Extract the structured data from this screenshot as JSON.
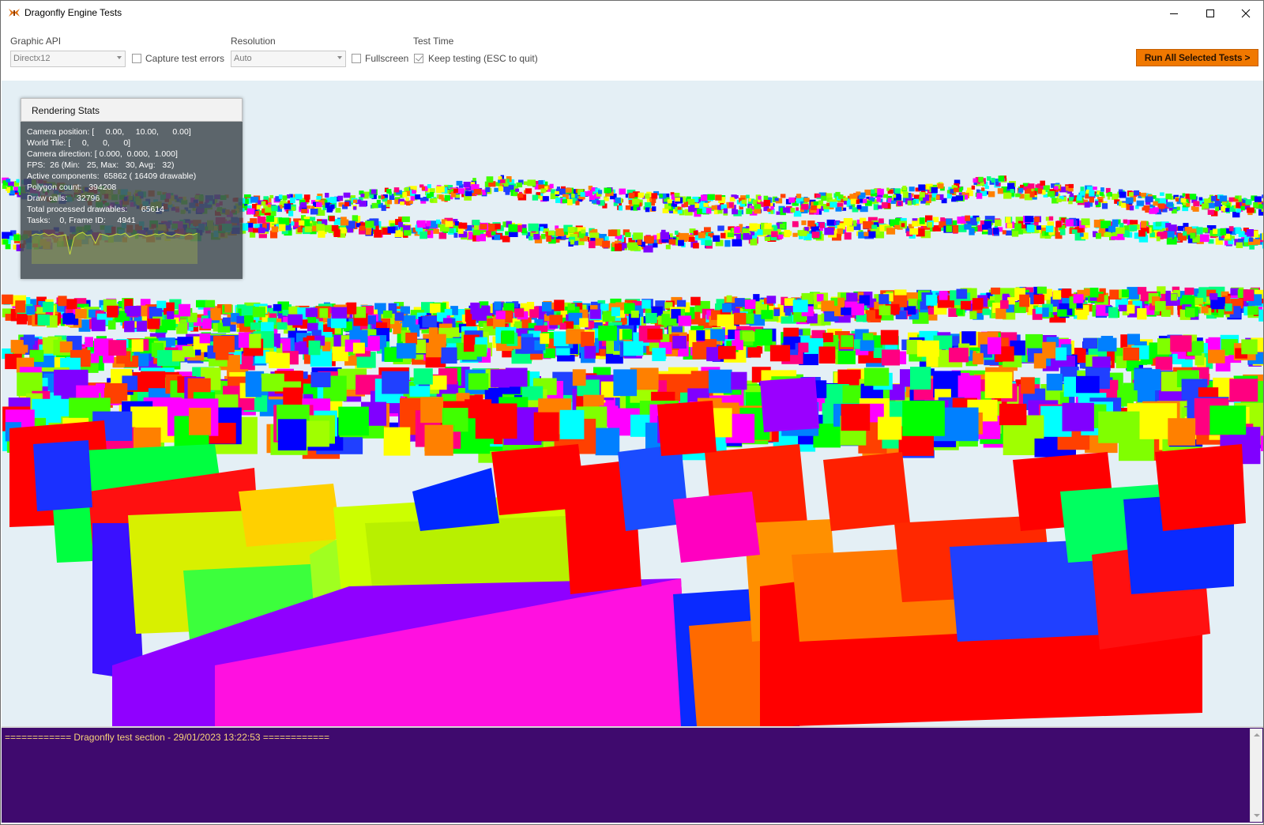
{
  "window": {
    "title": "Dragonfly Engine Tests",
    "controls": {
      "minimize": "minimize-icon",
      "maximize": "maximize-icon",
      "close": "close-icon"
    }
  },
  "toolbar": {
    "graphic_api": {
      "label": "Graphic API",
      "value": "Directx12"
    },
    "capture_errors": {
      "label": "Capture test errors",
      "checked": false
    },
    "resolution": {
      "label": "Resolution",
      "value": "Auto"
    },
    "fullscreen": {
      "label": "Fullscreen",
      "checked": false
    },
    "test_time": {
      "label": "Test Time"
    },
    "keep_testing": {
      "label": "Keep testing (ESC to quit)",
      "checked": true
    },
    "run_button": "Run All Selected Tests >",
    "accent_color": "#f07800"
  },
  "stats": {
    "title": "Rendering Stats",
    "lines": [
      "Camera position: [     0.00,     10.00,      0.00]",
      "World Tile: [     0,      0,      0]",
      "Camera direction: [ 0.000,  0.000,  1.000]",
      "FPS:  26 (Min:   25, Max:   30, Avg:   32)",
      "Active components:  65862 ( 16409 drawable)",
      "Polygon count:   394208",
      "Draw calls:    32796",
      "Total processed drawables:      65614",
      "Tasks:    0, Frame ID:     4941"
    ],
    "graph_color": "#c8e03a"
  },
  "console": {
    "lines": [
      "============ Dragonfly test section - 29/01/2023 13:22:53 ============"
    ],
    "background": "#3f0a6e",
    "text_color": "#f7d27a"
  }
}
